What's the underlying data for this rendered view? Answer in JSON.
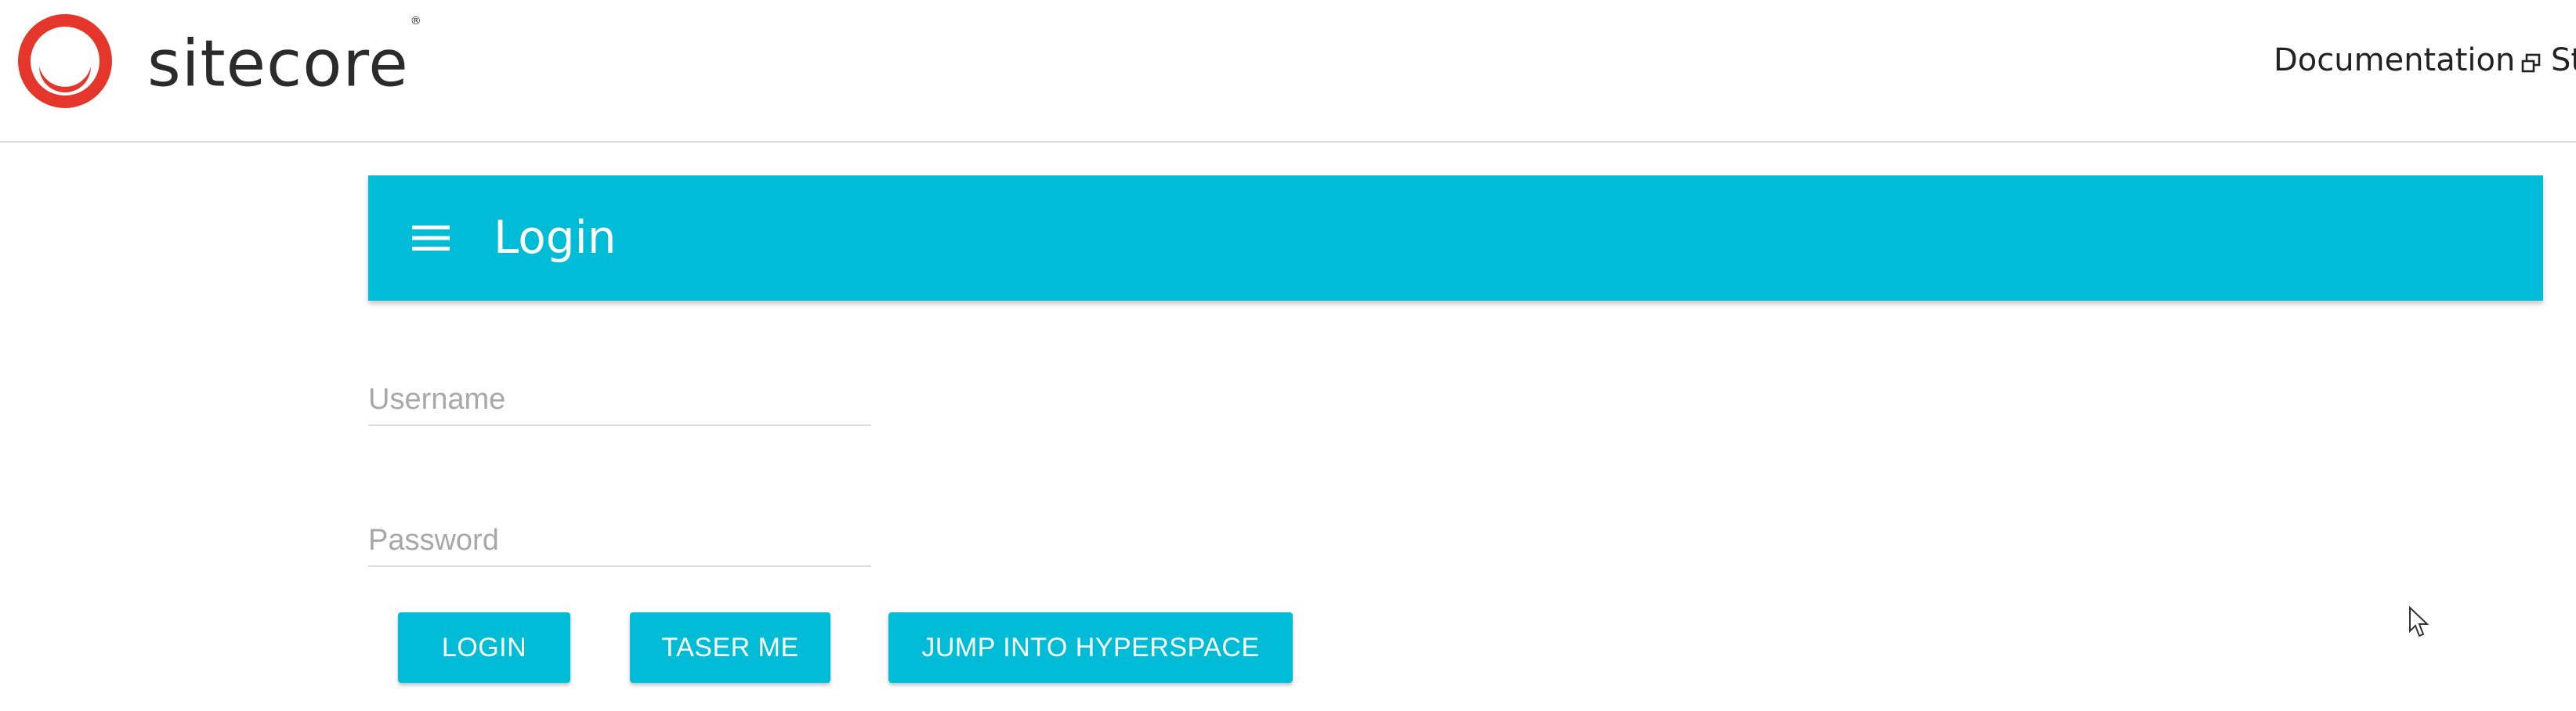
{
  "header": {
    "brand": "sitecore",
    "brand_mark": "®",
    "nav": {
      "documentation": "Documentation",
      "truncated_link": "St"
    }
  },
  "appbar": {
    "title": "Login",
    "color": "#00bcd6"
  },
  "form": {
    "username": {
      "placeholder": "Username",
      "value": ""
    },
    "password": {
      "placeholder": "Password",
      "value": ""
    }
  },
  "buttons": {
    "login": "LOGIN",
    "taser": "TASER ME",
    "hyperspace": "JUMP INTO HYPERSPACE"
  },
  "icons": {
    "logo": "sitecore-logo-icon",
    "external": "external-link-icon",
    "menu": "hamburger-menu-icon",
    "cursor": "mouse-cursor-icon"
  }
}
